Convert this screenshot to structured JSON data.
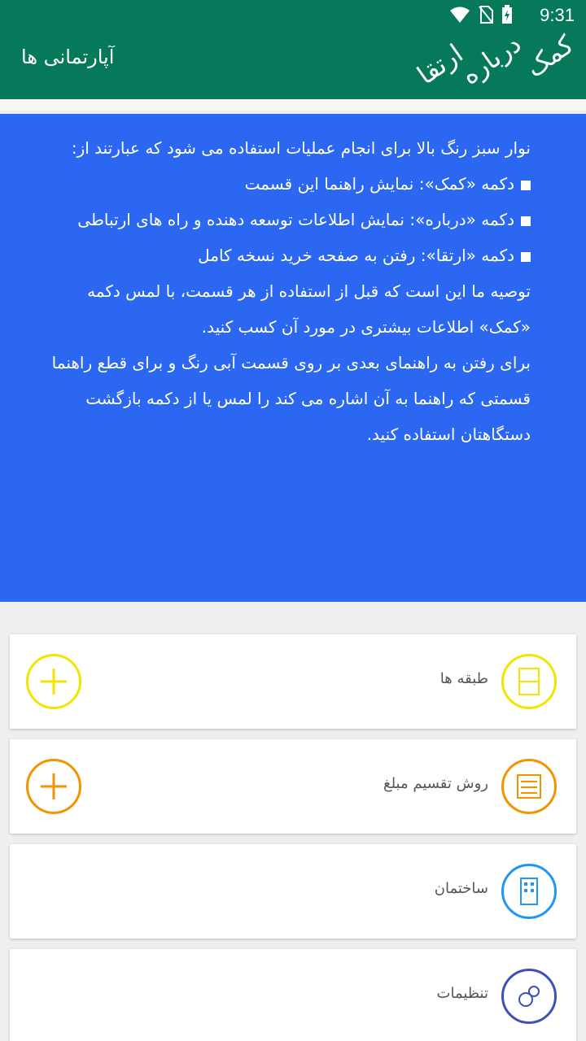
{
  "status_bar": {
    "time": "9:31"
  },
  "app_bar": {
    "title": "آپارتمانی ها",
    "actions": {
      "help": "کمک",
      "about": "درباره",
      "upgrade": "ارتقا"
    },
    "color": "#05795a"
  },
  "cards": [
    {
      "label": "طبقه ها",
      "icon": "floors-icon",
      "color": "#f2e600",
      "has_add": true
    },
    {
      "label": "روش تقسیم مبلغ",
      "icon": "abacus-icon",
      "color": "#f29400",
      "has_add": true
    },
    {
      "label": "ساختمان",
      "icon": "building-icon",
      "color": "#2196f3",
      "has_add": false
    },
    {
      "label": "تنظیمات",
      "icon": "gears-icon",
      "color": "#3f51b5",
      "has_add": false
    }
  ],
  "overlay_color": "#0a50f0",
  "hint": {
    "intro": "نوار سبز رنگ بالا برای انجام عملیات استفاده می شود که عبارتند از:",
    "bullets": [
      "دکمه «کمک»: نمایش راهنما این قسمت",
      "دکمه «درباره»: نمایش اطلاعات توسعه دهنده و راه های ارتباطی",
      "دکمه «ارتقا»: رفتن به صفحه خرید نسخه کامل"
    ],
    "advice": "توصیه ما این است که قبل از استفاده از هر قسمت، با لمس دکمه «کمک» اطلاعات بیشتری در مورد آن کسب کنید.",
    "navigation": "برای رفتن به راهنمای بعدی بر روی قسمت آبی رنگ و برای قطع راهنما قسمتی که راهنما به آن اشاره می کند را لمس یا از دکمه بازگشت دستگاهتان استفاده کنید."
  }
}
